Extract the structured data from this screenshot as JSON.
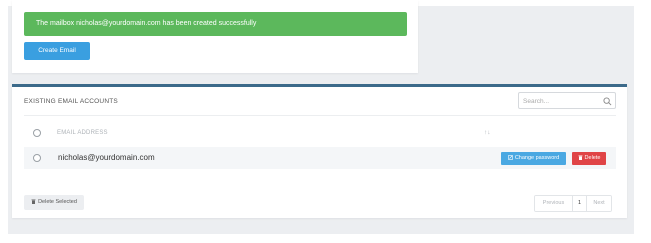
{
  "alert": {
    "message": "The mailbox nicholas@yourdomain.com has been created successfully"
  },
  "create_button": {
    "label": "Create Email"
  },
  "accounts": {
    "title": "EXISTING EMAIL ACCOUNTS",
    "search": {
      "placeholder": "Search...",
      "value": ""
    },
    "columns": {
      "email": "EMAIL ADDRESS",
      "sort_marker": "↑↓"
    },
    "rows": [
      {
        "email": "nicholas@yourdomain.com",
        "change_label": "Change password",
        "delete_label": "Delete"
      }
    ],
    "delete_selected_label": "Delete Selected",
    "pagination": {
      "prev": "Previous",
      "current": "1",
      "next": "Next"
    }
  },
  "colors": {
    "success": "#5cb85c",
    "primary": "#3a9fe0",
    "info": "#4aa8e2",
    "danger": "#e04446",
    "card_border": "#3c6a8a"
  }
}
